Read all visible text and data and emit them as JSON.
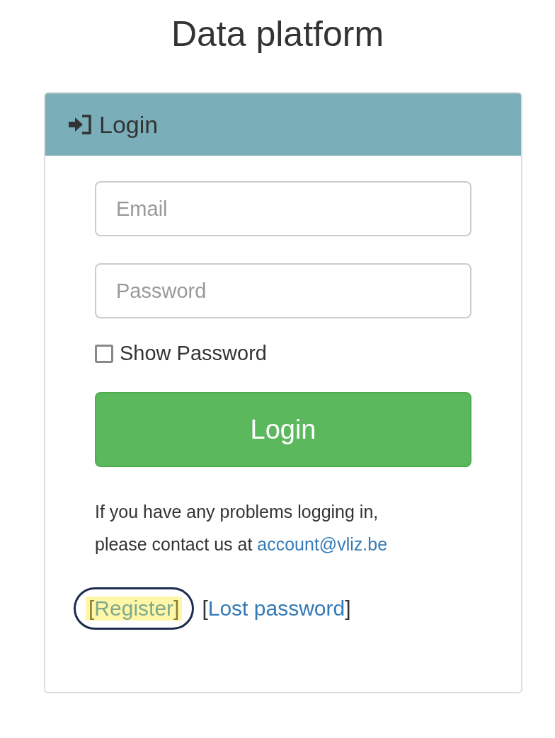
{
  "title": "Data platform",
  "panel": {
    "heading": "Login",
    "fields": [
      {
        "placeholder": "Email"
      },
      {
        "placeholder": "Password"
      }
    ],
    "show_password": {
      "label": "Show Password",
      "checked": false
    },
    "button": "Login",
    "help": {
      "text": "If you have any problems logging in, please contact us at",
      "link": "account@vliz.be"
    },
    "links": [
      {
        "open": "[",
        "label": "Register",
        "close": "]",
        "highlighted": true,
        "circled": true
      },
      {
        "open": "[",
        "label": "Lost password",
        "close": "]",
        "highlighted": false,
        "circled": false
      }
    ]
  }
}
